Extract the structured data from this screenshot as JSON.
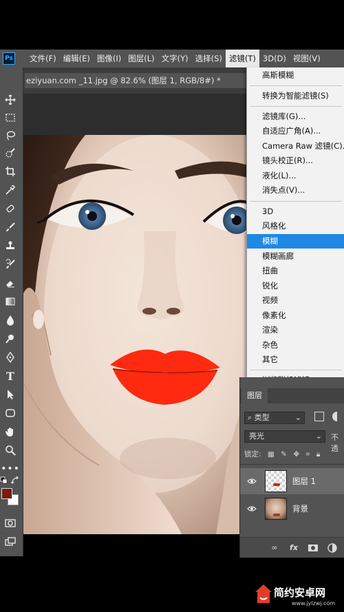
{
  "app": {
    "logo": "Ps"
  },
  "menu": {
    "items": [
      {
        "label": "文件(F)"
      },
      {
        "label": "编辑(E)"
      },
      {
        "label": "图像(I)"
      },
      {
        "label": "图层(L)"
      },
      {
        "label": "文字(Y)"
      },
      {
        "label": "选择(S)"
      },
      {
        "label": "滤镜(T)"
      },
      {
        "label": "3D(D)"
      },
      {
        "label": "视图(V)"
      }
    ]
  },
  "document": {
    "tab_title": "eziyuan.com _11.jpg @ 82.6% (图层 1, RGB/8#) *"
  },
  "filter_menu": {
    "last_filter": "高斯模糊",
    "convert_smart": "转换为智能滤镜(S)",
    "gallery": "滤镜库(G)...",
    "adaptive_wide": "自适应广角(A)...",
    "camera_raw": "Camera Raw 滤镜(C)...",
    "lens_correction": "镜头校正(R)...",
    "liquify": "液化(L)...",
    "vanishing_point": "消失点(V)...",
    "groups": [
      "3D",
      "风格化",
      "模糊",
      "模糊画廊",
      "扭曲",
      "锐化",
      "视频",
      "像素化",
      "渲染",
      "杂色",
      "其它"
    ],
    "selected_group": "模糊",
    "browse_online": "浏览联机滤镜..."
  },
  "layers_panel": {
    "tab": "图层",
    "filter_kind": "类型",
    "blend_mode": "亮光",
    "opacity_label_partial": "不透",
    "lock_label": "锁定:",
    "layers": [
      {
        "name": "图层 1",
        "selected": true
      },
      {
        "name": "背景",
        "selected": false
      }
    ]
  },
  "colors": {
    "foreground": "#7b1a10",
    "background": "#ffffff",
    "menu_highlight": "#1e88e5",
    "lip_color": "#ff2a0f"
  },
  "watermark": {
    "title": "简约安卓网",
    "url": "www.jylzwj.com"
  }
}
